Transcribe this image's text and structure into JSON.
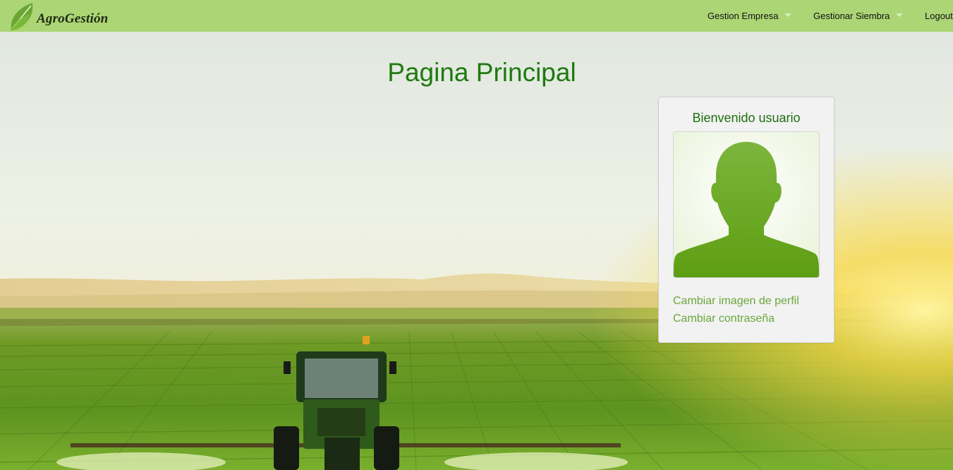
{
  "brand": {
    "name": "AgroGestión",
    "icon": "leaf-icon"
  },
  "nav": {
    "items": [
      {
        "label": "Gestion Empresa",
        "dropdown": true
      },
      {
        "label": "Gestionar Siembra",
        "dropdown": true
      },
      {
        "label": "Logout",
        "dropdown": false
      }
    ]
  },
  "main": {
    "title": "Pagina Principal"
  },
  "profile": {
    "welcome": "Bienvenido usuario",
    "avatar_icon": "user-silhouette-icon",
    "links": [
      "Cambiar imagen de perfil",
      "Cambiar contraseña"
    ]
  },
  "colors": {
    "navbar": "#acd575",
    "title": "#1f7a0f",
    "link": "#6aa73a",
    "panel": "#f2f2f2"
  }
}
